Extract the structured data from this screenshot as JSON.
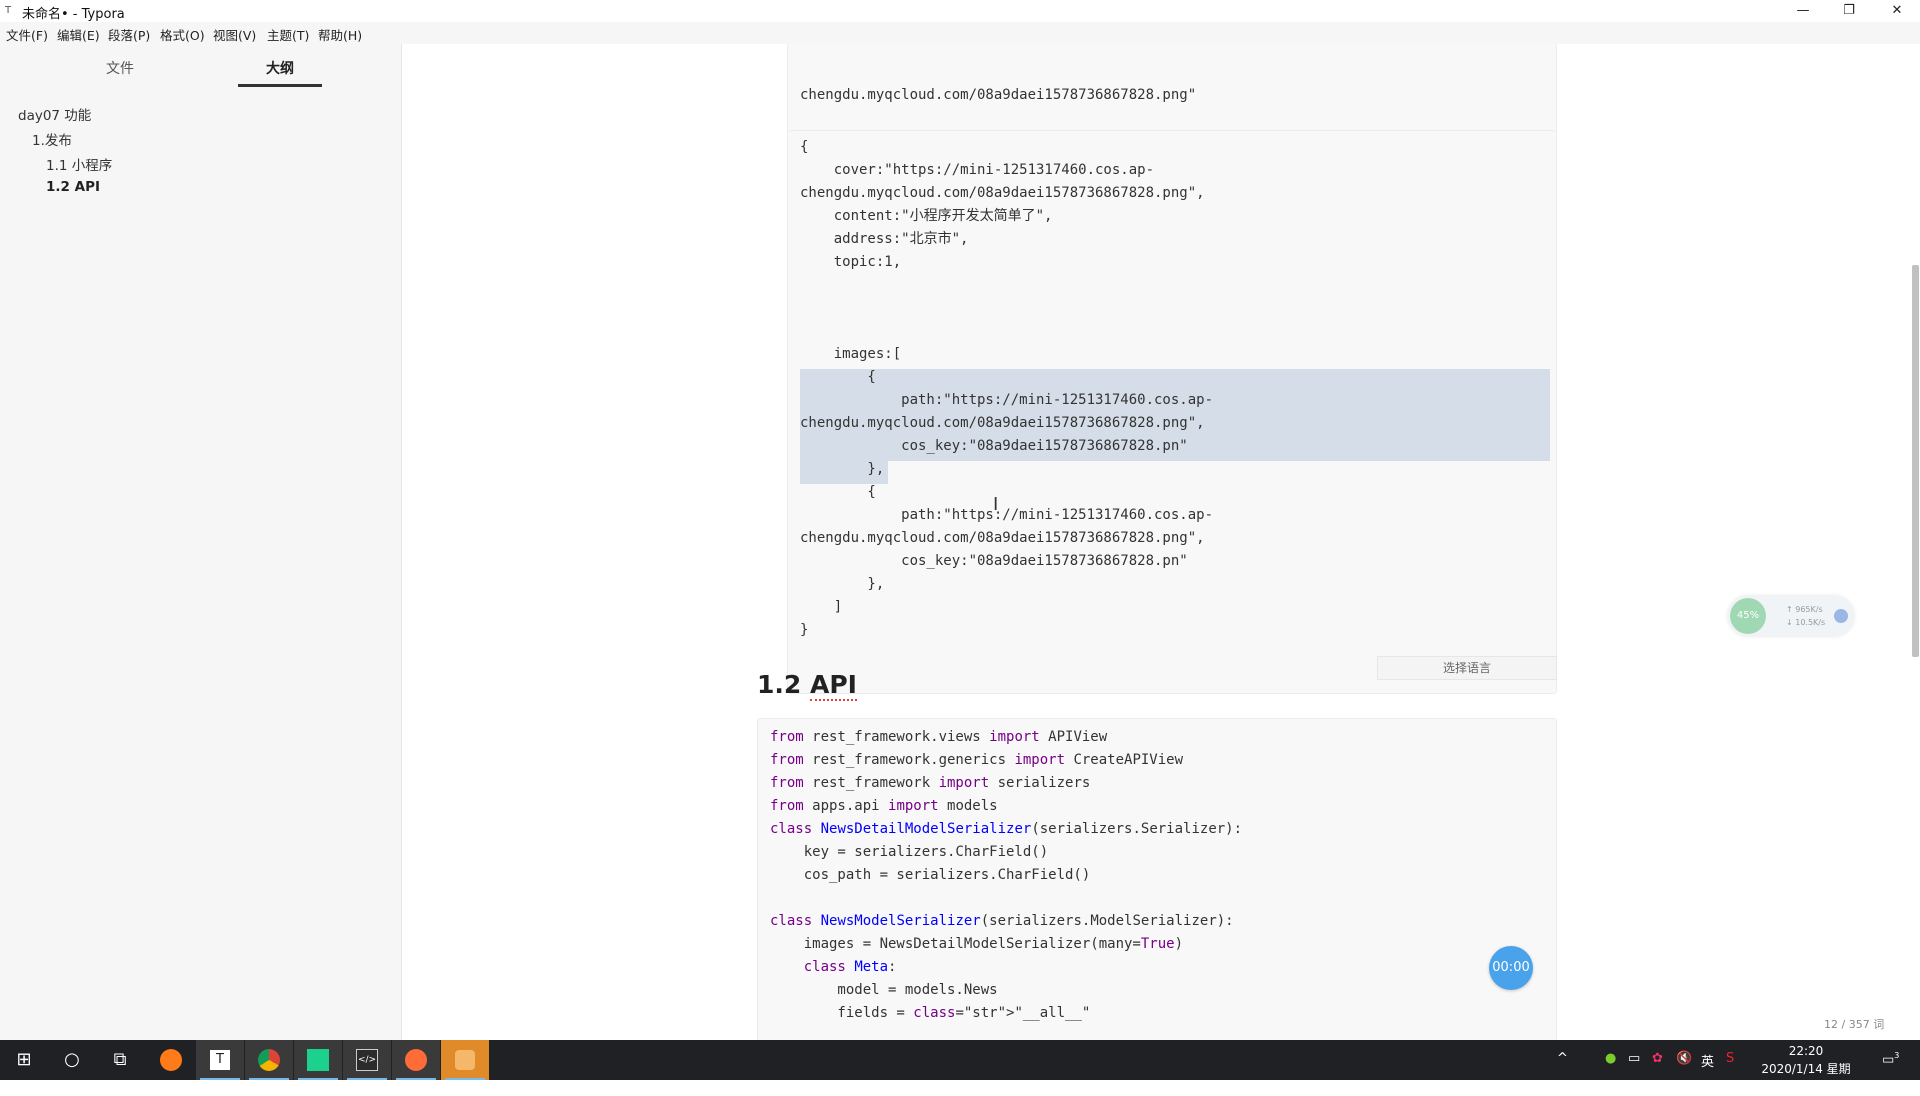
{
  "window": {
    "title": "未命名• - Typora",
    "minimize": "—",
    "restore": "❐",
    "close": "✕"
  },
  "menu": [
    "文件(F)",
    "编辑(E)",
    "段落(P)",
    "格式(O)",
    "视图(V)",
    "主题(T)",
    "帮助(H)"
  ],
  "sidebar": {
    "tabs": [
      {
        "label": "文件",
        "active": false
      },
      {
        "label": "大纲",
        "active": true
      }
    ],
    "outline": [
      {
        "label": "day07 功能",
        "level": 1,
        "active": false
      },
      {
        "label": "1.发布",
        "level": 2,
        "active": false
      },
      {
        "label": "1.1 小程序",
        "level": 3,
        "active": false
      },
      {
        "label": "1.2 API",
        "level": 3,
        "active": true
      }
    ],
    "footer": {
      "prev": "‹",
      "source": "</>"
    }
  },
  "editor": {
    "block1_tail": [
      "chengdu.myqcloud.com/08a9daei1578736867828.png\"",
      "    ]",
      "}"
    ],
    "block2": [
      "{",
      "    cover:\"https://mini-1251317460.cos.ap-",
      "chengdu.myqcloud.com/08a9daei1578736867828.png\",",
      "    content:\"小程序开发太简单了\",",
      "    address:\"北京市\",",
      "    topic:1,",
      "",
      "",
      "",
      "    images:[",
      "        {",
      "            path:\"https://mini-1251317460.cos.ap-",
      "chengdu.myqcloud.com/08a9daei1578736867828.png\",",
      "            cos_key:\"08a9daei1578736867828.pn\"",
      "        },",
      "        {",
      "            path:\"https://mini-1251317460.cos.ap-",
      "chengdu.myqcloud.com/08a9daei1578736867828.png\",",
      "            cos_key:\"08a9daei1578736867828.pn\"",
      "        },",
      "    ]",
      "}"
    ],
    "language_select": "选择语言",
    "heading_number": "1.2 ",
    "heading_text": "API",
    "python_code": [
      "from rest_framework.views import APIView",
      "from rest_framework.generics import CreateAPIView",
      "from rest_framework import serializers",
      "from apps.api import models",
      "class NewsDetailModelSerializer(serializers.Serializer):",
      "    key = serializers.CharField()",
      "    cos_path = serializers.CharField()",
      "",
      "class NewsModelSerializer(serializers.ModelSerializer):",
      "    images = NewsDetailModelSerializer(many=True)",
      "    class Meta:",
      "        model = models.News",
      "        fields = \"__all__\""
    ]
  },
  "widgets": {
    "net_percent": "45%",
    "net_up": "↑ 965K/s",
    "net_down": "↓ 10.5K/s",
    "timer": "00:00",
    "wordcount": "12 / 357 词"
  },
  "taskbar": {
    "start": "⊞",
    "search": "○",
    "taskview": "⧉",
    "apps": [
      "firefox-icon",
      "typora-icon",
      "chrome-icon",
      "pycharm-icon",
      "code-editor-icon",
      "postman-icon",
      "app-icon"
    ],
    "tray": [
      "^",
      "●",
      "▭",
      "✿",
      "🔇",
      "英",
      "S"
    ],
    "time": "22:20",
    "date": "2020/1/14 星期二",
    "notification": "3"
  }
}
